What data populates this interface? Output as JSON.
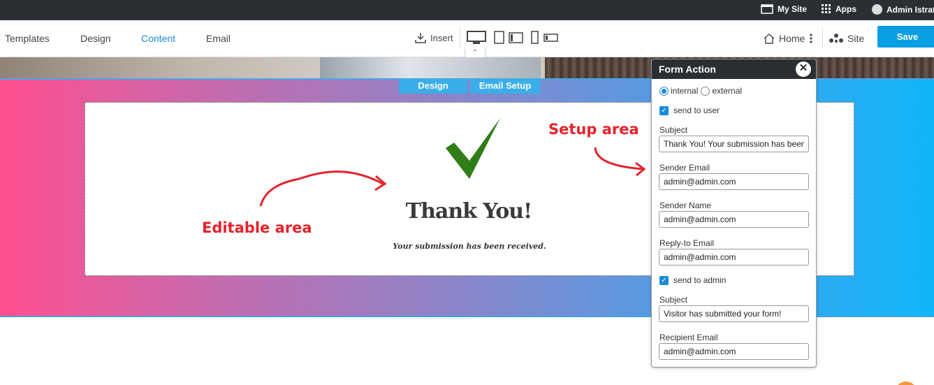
{
  "topbar": {
    "my_site": "My Site",
    "apps": "Apps",
    "user": "Admin Istrato"
  },
  "nav": {
    "templates": "Templates",
    "design": "Design",
    "content": "Content",
    "email": "Email",
    "insert": "Insert",
    "home": "Home",
    "site": "Site",
    "save": "Save"
  },
  "section_tabs": {
    "design": "Design",
    "email_setup": "Email Setup"
  },
  "content": {
    "title": "Thank You!",
    "subtitle": "Your submission has been received.",
    "annot_editable": "Editable area",
    "annot_setup": "Setup area"
  },
  "panel": {
    "title": "Form Action",
    "radio_internal": "internal",
    "radio_external": "external",
    "send_to_user": "send to user",
    "subject_label": "Subject",
    "subject_value": "Thank You! Your submission has been received.",
    "sender_email_label": "Sender Email",
    "sender_email_value": "admin@admin.com",
    "sender_name_label": "Sender Name",
    "sender_name_value": "admin@admin.com",
    "reply_to_label": "Reply-to Email",
    "reply_to_value": "admin@admin.com",
    "send_to_admin": "send to admin",
    "admin_subject_label": "Subject",
    "admin_subject_value": "Visitor has submitted your form!",
    "recipient_label": "Recipient Email",
    "recipient_value": "admin@admin.com"
  },
  "colors": {
    "accent": "#0a9ee3",
    "annotation": "#e5232c",
    "check": "#2f7d16"
  }
}
